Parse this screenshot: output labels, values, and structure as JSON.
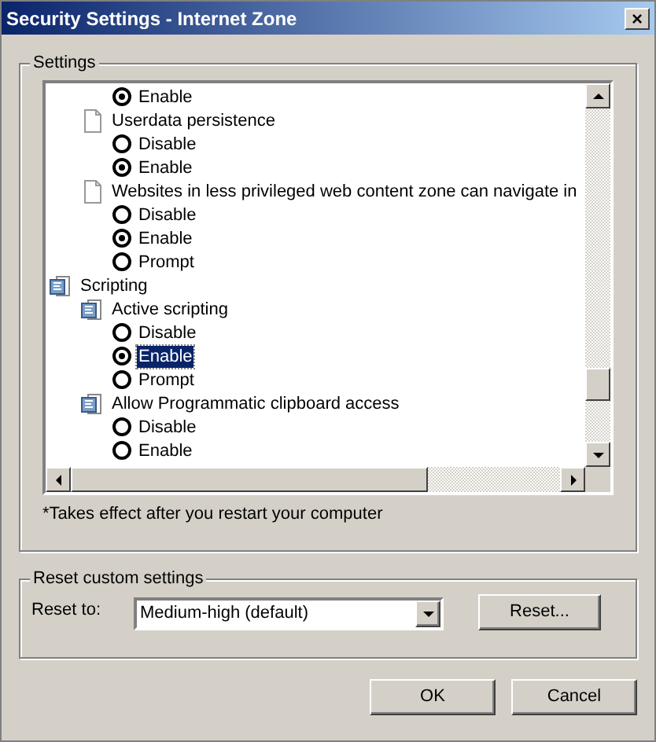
{
  "window": {
    "title": "Security Settings - Internet Zone",
    "close": "×"
  },
  "settings": {
    "legend": "Settings",
    "items": [
      {
        "kind": "option",
        "label": "Enable",
        "selected": true,
        "highlighted": false
      },
      {
        "kind": "setting",
        "label": "Userdata persistence",
        "children": [
          {
            "kind": "option",
            "label": "Disable",
            "selected": false,
            "highlighted": false
          },
          {
            "kind": "option",
            "label": "Enable",
            "selected": true,
            "highlighted": false
          }
        ]
      },
      {
        "kind": "setting",
        "label": "Websites in less privileged web content zone can navigate in",
        "children": [
          {
            "kind": "option",
            "label": "Disable",
            "selected": false,
            "highlighted": false
          },
          {
            "kind": "option",
            "label": "Enable",
            "selected": true,
            "highlighted": false
          },
          {
            "kind": "option",
            "label": "Prompt",
            "selected": false,
            "highlighted": false
          }
        ]
      },
      {
        "kind": "category",
        "label": "Scripting",
        "children": [
          {
            "kind": "script-setting",
            "label": "Active scripting",
            "children": [
              {
                "kind": "option",
                "label": "Disable",
                "selected": false,
                "highlighted": false
              },
              {
                "kind": "option",
                "label": "Enable",
                "selected": true,
                "highlighted": true
              },
              {
                "kind": "option",
                "label": "Prompt",
                "selected": false,
                "highlighted": false
              }
            ]
          },
          {
            "kind": "script-setting",
            "label": "Allow Programmatic clipboard access",
            "children": [
              {
                "kind": "option",
                "label": "Disable",
                "selected": false,
                "highlighted": false
              },
              {
                "kind": "option",
                "label": "Enable",
                "selected": false,
                "highlighted": false
              }
            ]
          }
        ]
      }
    ],
    "note": "*Takes effect after you restart your computer"
  },
  "reset": {
    "legend": "Reset custom settings",
    "label": "Reset to:",
    "value": "Medium-high (default)",
    "button": "Reset..."
  },
  "buttons": [
    "OK",
    "Cancel"
  ]
}
